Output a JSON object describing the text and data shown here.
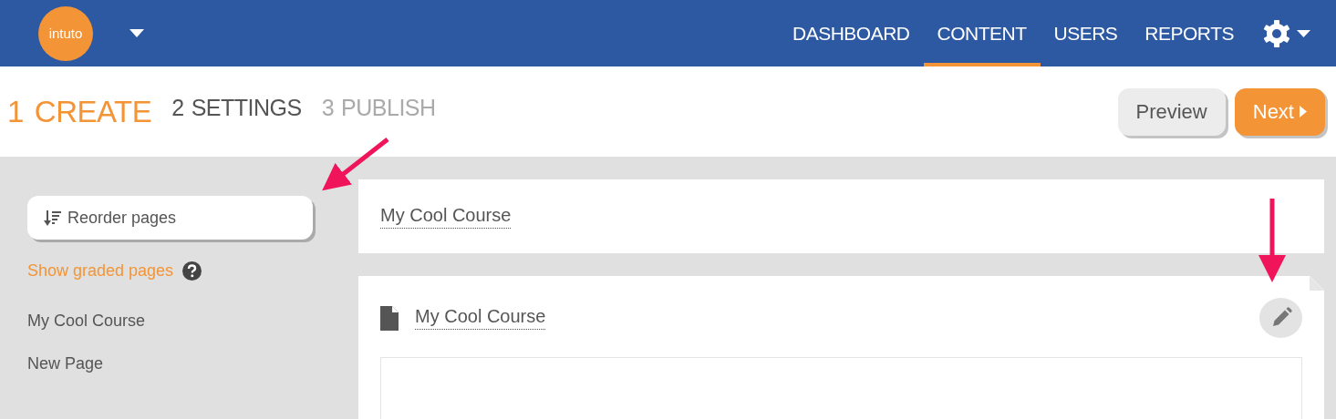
{
  "header": {
    "logo": "intuto",
    "nav": [
      {
        "label": "DASHBOARD",
        "selected": false
      },
      {
        "label": "CONTENT",
        "selected": true
      },
      {
        "label": "USERS",
        "selected": false
      },
      {
        "label": "REPORTS",
        "selected": false
      }
    ]
  },
  "steps": [
    {
      "number": "1",
      "label": "CREATE",
      "selected": true,
      "disabled": false
    },
    {
      "number": "2",
      "label": "SETTINGS",
      "selected": false,
      "disabled": false
    },
    {
      "number": "3",
      "label": "PUBLISH",
      "selected": false,
      "disabled": true
    }
  ],
  "actions": {
    "preview": "Preview",
    "next": "Next"
  },
  "sidebar": {
    "reorder": "Reorder pages",
    "graded_link": "Show graded pages",
    "pages": [
      "My Cool Course",
      "New Page"
    ]
  },
  "course": {
    "title": "My Cool Course",
    "page_title": "My Cool Course"
  }
}
